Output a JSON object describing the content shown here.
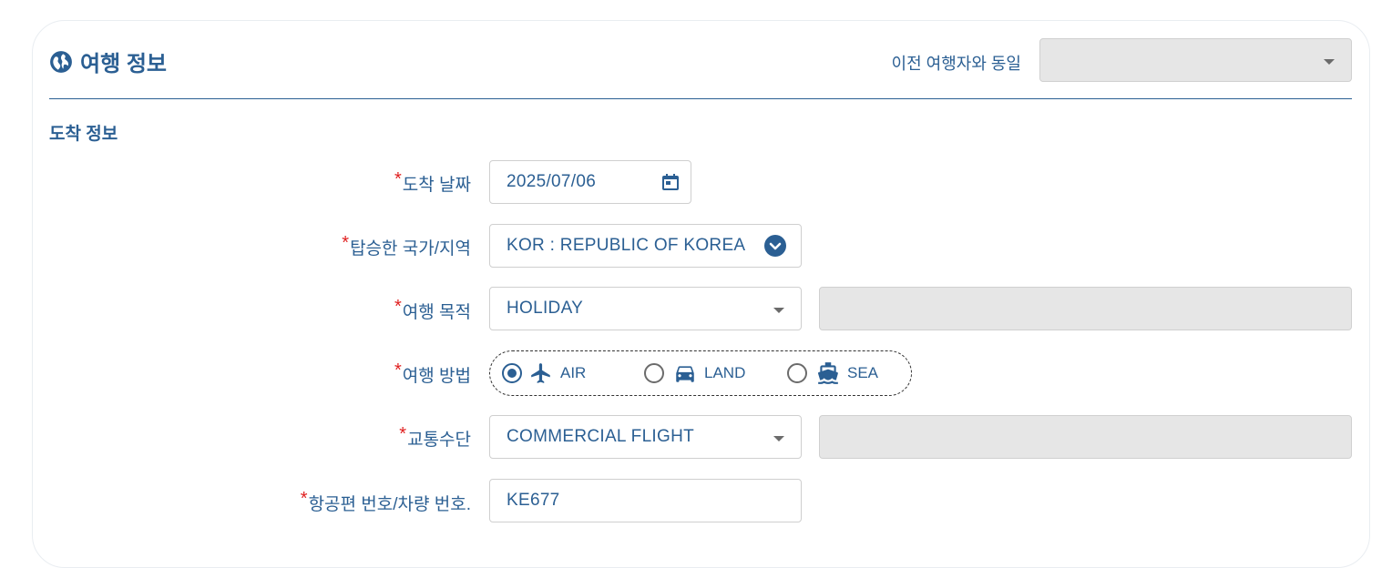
{
  "section": {
    "title": "여행 정보",
    "icon": "globe-icon"
  },
  "same_as_previous": {
    "label": "이전 여행자와 동일",
    "value": ""
  },
  "arrival": {
    "title": "도착 정보"
  },
  "fields": {
    "arrival_date": {
      "label": "도착 날짜",
      "value": "2025/07/06"
    },
    "boarding_country": {
      "label": "탑승한 국가/지역",
      "value": "KOR : REPUBLIC OF KOREA"
    },
    "purpose": {
      "label": "여행 목적",
      "value": "HOLIDAY",
      "extra_value": ""
    },
    "travel_mode": {
      "label": "여행 방법",
      "options": [
        {
          "label": "AIR",
          "icon": "airplane-icon",
          "selected": true
        },
        {
          "label": "LAND",
          "icon": "car-icon",
          "selected": false
        },
        {
          "label": "SEA",
          "icon": "ship-icon",
          "selected": false
        }
      ]
    },
    "transport": {
      "label": "교통수단",
      "value": "COMMERCIAL FLIGHT",
      "extra_value": ""
    },
    "flight_no": {
      "label": "항공편 번호/차량 번호.",
      "value": "KE677"
    }
  },
  "required_mark": "*",
  "colors": {
    "primary": "#2b5f93",
    "required": "#e02020",
    "disabled_bg": "#e6e6e6"
  }
}
